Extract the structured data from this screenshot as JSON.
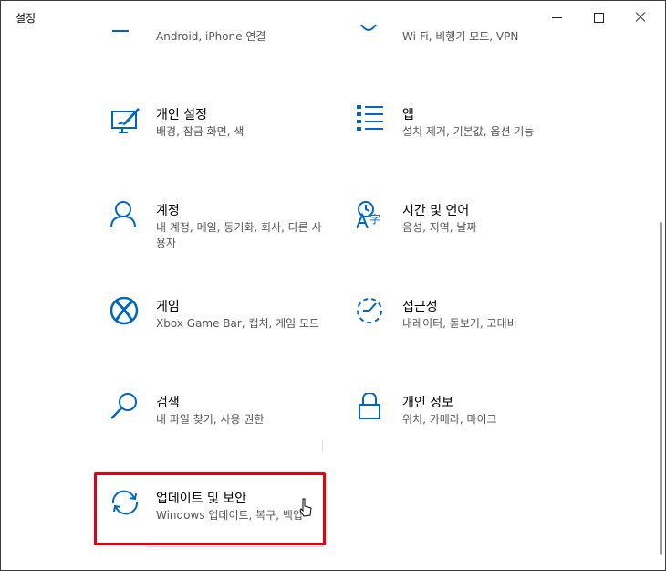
{
  "window": {
    "title": "설정",
    "controls": {
      "minimize": "minimize-icon",
      "maximize": "maximize-icon",
      "close": "close-icon"
    }
  },
  "partial_row": {
    "left_desc": "Android, iPhone 연결",
    "right_desc": "Wi-Fi, 비행기 모드, VPN"
  },
  "tiles": [
    {
      "name": "개인 설정",
      "desc": "배경, 잠금 화면, 색",
      "icon": "personalization-icon"
    },
    {
      "name": "앱",
      "desc": "설치 제거, 기본값, 옵션 기능",
      "icon": "apps-icon"
    },
    {
      "name": "계정",
      "desc": "내 계정, 메일, 동기화, 회사, 다른 사용자",
      "icon": "account-icon"
    },
    {
      "name": "시간 및 언어",
      "desc": "음성, 지역, 날짜",
      "icon": "time-language-icon"
    },
    {
      "name": "게임",
      "desc": "Xbox Game Bar, 캡처, 게임 모드",
      "icon": "xbox-icon"
    },
    {
      "name": "접근성",
      "desc": "내레이터, 돋보기, 고대비",
      "icon": "accessibility-icon"
    },
    {
      "name": "검색",
      "desc": "내 파일 찾기, 사용 권한",
      "icon": "search-icon"
    },
    {
      "name": "개인 정보",
      "desc": "위치, 카메라, 마이크",
      "icon": "lock-icon"
    },
    {
      "name": "업데이트 및 보안",
      "desc": "Windows 업데이트, 복구, 백업",
      "icon": "sync-icon"
    }
  ],
  "colors": {
    "accent": "#0067c0",
    "highlight": "#e8000c"
  }
}
